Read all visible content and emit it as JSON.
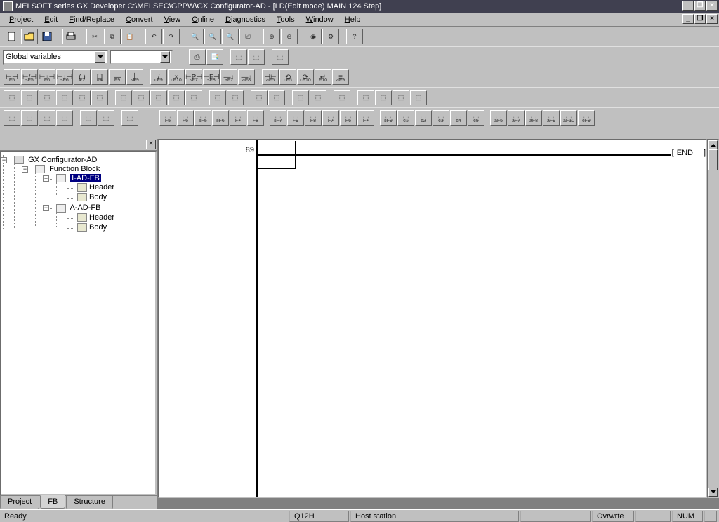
{
  "title": "MELSOFT series GX Developer C:\\MELSEC\\GPPW\\GX Configurator-AD - [LD(Edit mode)    MAIN    124 Step]",
  "menu": {
    "project": "Project",
    "edit": "Edit",
    "find": "Find/Replace",
    "convert": "Convert",
    "view": "View",
    "online": "Online",
    "diagnostics": "Diagnostics",
    "tools": "Tools",
    "window": "Window",
    "help": "Help"
  },
  "combos": {
    "globals": "Global variables",
    "unit": ""
  },
  "fkeys_row1": [
    "F5",
    "sF5",
    "F6",
    "sF6",
    "F7",
    "F8",
    "F9",
    "sF9",
    "cF9",
    "cF10",
    "sF7",
    "sF8",
    "aF7",
    "aF8",
    "aF5",
    "cF5",
    "cF10",
    "F10",
    "aF9"
  ],
  "tree": {
    "root": "GX Configurator-AD",
    "fb": "Function Block",
    "iadfb": "I-AD-FB",
    "aadfb": "A-AD-FB",
    "header": "Header",
    "body": "Body",
    "tabs": {
      "project": "Project",
      "fb": "FB",
      "structure": "Structure"
    }
  },
  "ladder": {
    "step": "89",
    "end": "END"
  },
  "status": {
    "ready": "Ready",
    "cpu": "Q12H",
    "host": "Host station",
    "mode": "Ovrwrte",
    "num": "NUM"
  }
}
